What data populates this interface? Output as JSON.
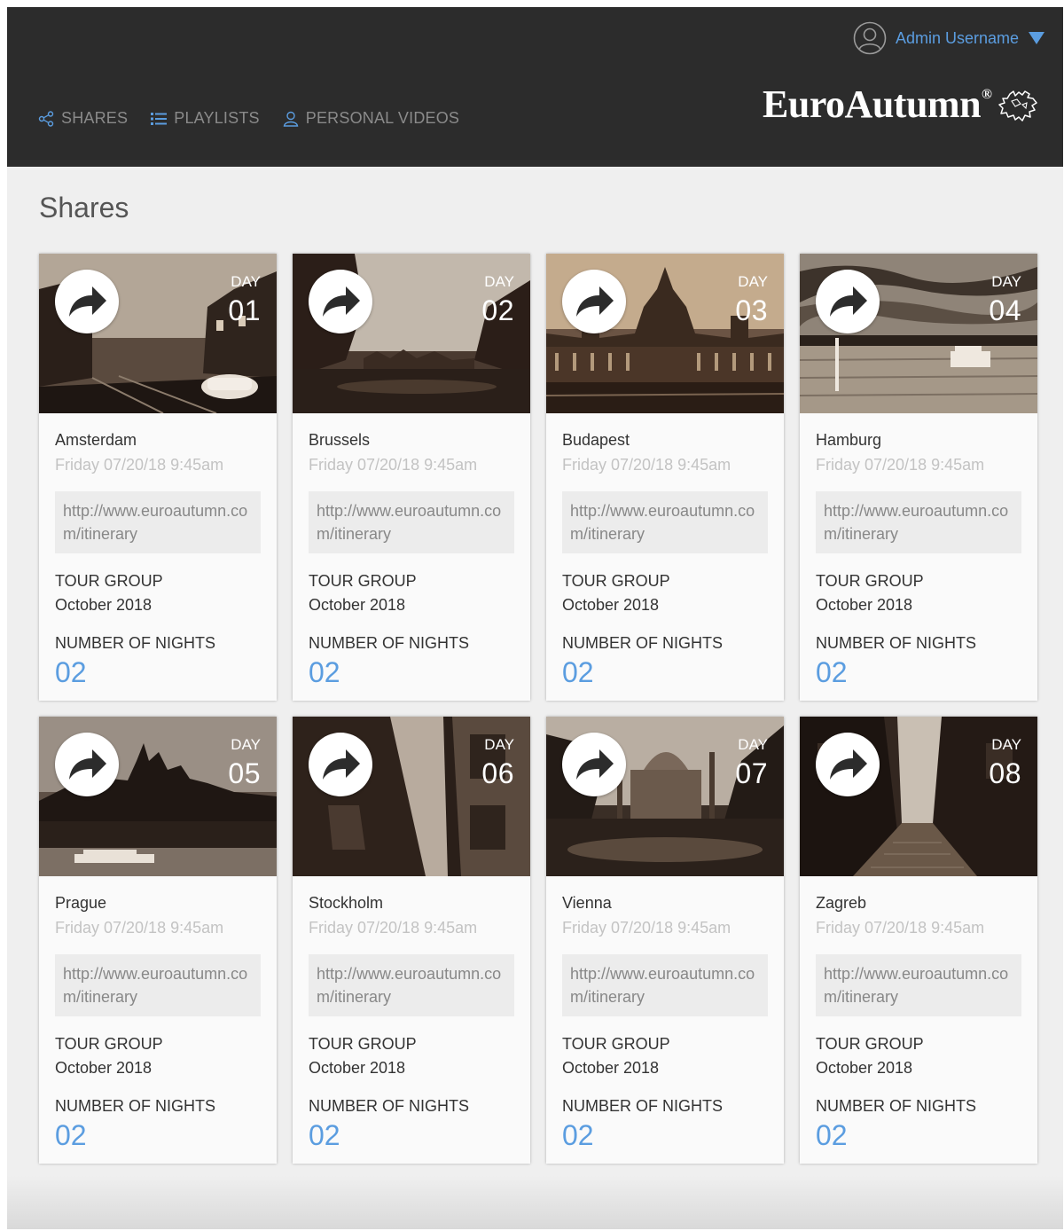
{
  "header": {
    "user_name": "Admin Username",
    "brand_name": "EuroAutumn",
    "brand_mark": "®",
    "nav": [
      {
        "label": "SHARES",
        "icon": "share-icon"
      },
      {
        "label": "PLAYLISTS",
        "icon": "list-icon"
      },
      {
        "label": "PERSONAL VIDEOS",
        "icon": "user-icon"
      }
    ]
  },
  "page": {
    "title": "Shares"
  },
  "labels": {
    "day": "DAY",
    "tour_group": "TOUR GROUP",
    "number_of_nights": "NUMBER OF NIGHTS"
  },
  "colors": {
    "accent": "#5b9de0",
    "header_bg": "#2c2c2c",
    "nav_text": "#8a8a8a",
    "muted_text": "#c3c3c3"
  },
  "shares": [
    {
      "day": "01",
      "city": "Amsterdam",
      "date": "Friday 07/20/18 9:45am",
      "url": "http://www.euroautumn.com/itinerary",
      "tour_group": "October 2018",
      "nights": "02",
      "image": "street-scene"
    },
    {
      "day": "02",
      "city": "Brussels",
      "date": "Friday 07/20/18 9:45am",
      "url": "http://www.euroautumn.com/itinerary",
      "tour_group": "October 2018",
      "nights": "02",
      "image": "square-scene"
    },
    {
      "day": "03",
      "city": "Budapest",
      "date": "Friday 07/20/18 9:45am",
      "url": "http://www.euroautumn.com/itinerary",
      "tour_group": "October 2018",
      "nights": "02",
      "image": "parliament-scene"
    },
    {
      "day": "04",
      "city": "Hamburg",
      "date": "Friday 07/20/18 9:45am",
      "url": "http://www.euroautumn.com/itinerary",
      "tour_group": "October 2018",
      "nights": "02",
      "image": "lake-scene"
    },
    {
      "day": "05",
      "city": "Prague",
      "date": "Friday 07/20/18 9:45am",
      "url": "http://www.euroautumn.com/itinerary",
      "tour_group": "October 2018",
      "nights": "02",
      "image": "castle-scene"
    },
    {
      "day": "06",
      "city": "Stockholm",
      "date": "Friday 07/20/18 9:45am",
      "url": "http://www.euroautumn.com/itinerary",
      "tour_group": "October 2018",
      "nights": "02",
      "image": "buildings-scene"
    },
    {
      "day": "07",
      "city": "Vienna",
      "date": "Friday 07/20/18 9:45am",
      "url": "http://www.euroautumn.com/itinerary",
      "tour_group": "October 2018",
      "nights": "02",
      "image": "church-scene"
    },
    {
      "day": "08",
      "city": "Zagreb",
      "date": "Friday 07/20/18 9:45am",
      "url": "http://www.euroautumn.com/itinerary",
      "tour_group": "October 2018",
      "nights": "02",
      "image": "alley-scene"
    }
  ]
}
